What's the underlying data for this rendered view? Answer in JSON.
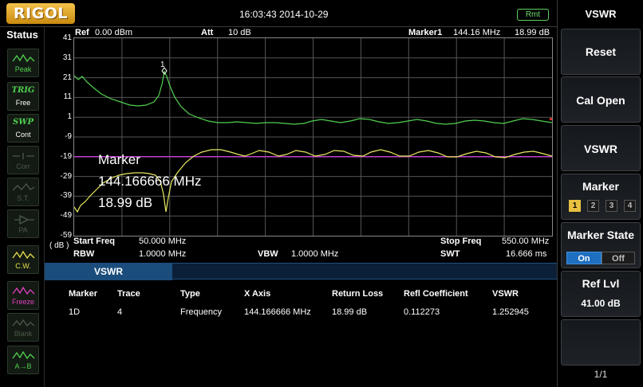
{
  "brand": "RIGOL",
  "datetime": "16:03:43 2014-10-29",
  "remote_badge": "Rmt",
  "status_panel": {
    "title": "Status",
    "buttons": [
      {
        "label": "Peak",
        "icon": "peak-icon",
        "color": "#4fd04f"
      },
      {
        "label": "Free",
        "top_text": "TRIG",
        "color": "#4fd04f"
      },
      {
        "label": "Cont",
        "top_text": "SWP",
        "color": "#4fd04f"
      },
      {
        "label": "Corr",
        "icon": "corr-icon",
        "color": "#4a5a4a"
      },
      {
        "label": "S.T.",
        "icon": "st-icon",
        "color": "#4a5a4a"
      },
      {
        "label": "PA",
        "icon": "pa-icon",
        "color": "#4a5a4a"
      },
      {
        "label": "C.W.",
        "icon": "cw-icon",
        "color": "#e8e050"
      },
      {
        "label": "Freeze",
        "icon": "freeze-icon",
        "color": "#e040c0"
      },
      {
        "label": "Blank",
        "icon": "blank-icon",
        "color": "#4a5a4a"
      },
      {
        "label": "A→B",
        "icon": "a-to-b-icon",
        "color": "#4fd04f"
      }
    ]
  },
  "header": {
    "ref_label": "Ref",
    "ref_value": "0.00 dBm",
    "att_label": "Att",
    "att_value": "10 dB",
    "marker_label": "Marker1",
    "marker_freq": "144.16 MHz",
    "marker_level": "18.99 dB"
  },
  "y_axis": {
    "unit_label": "( dB )",
    "ticks": [
      "41",
      "31",
      "21",
      "11",
      "1",
      "-9",
      "-19",
      "-29",
      "-39",
      "-49",
      "-59"
    ]
  },
  "marker_overlay": {
    "line1": "Marker",
    "line2": "144.166666 MHz",
    "line3": "18.99 dB",
    "marker_number": "1"
  },
  "footer": {
    "start_label": "Start Freq",
    "start_value": "50.000 MHz",
    "stop_label": "Stop Freq",
    "stop_value": "550.00 MHz",
    "rbw_label": "RBW",
    "rbw_value": "1.0000 MHz",
    "vbw_label": "VBW",
    "vbw_value": "1.0000 MHz",
    "swt_label": "SWT",
    "swt_value": "16.666 ms"
  },
  "trace_colors": {
    "vswr_trace": "#50d050",
    "return_loss_trace": "#e8e860",
    "limit_line": "#c040d0"
  },
  "limit_line_db": -19,
  "vswr_table": {
    "tab": "VSWR",
    "columns": [
      "Marker",
      "Trace",
      "Type",
      "X Axis",
      "Return Loss",
      "Refl Coefficient",
      "VSWR"
    ],
    "rows": [
      [
        "1D",
        "4",
        "Frequency",
        "144.166666 MHz",
        "18.99 dB",
        "0.112273",
        "1.252945"
      ]
    ]
  },
  "softkeys": {
    "title": "VSWR",
    "reset": "Reset",
    "cal_open": "Cal Open",
    "vswr": "VSWR",
    "marker_label": "Marker",
    "marker_options": [
      "1",
      "2",
      "3",
      "4"
    ],
    "marker_selected": "1",
    "marker_state_label": "Marker State",
    "state_on": "On",
    "state_off": "Off",
    "state_selected": "On",
    "ref_lvl_label": "Ref Lvl",
    "ref_lvl_value": "41.00 dB",
    "page": "1/1"
  }
}
